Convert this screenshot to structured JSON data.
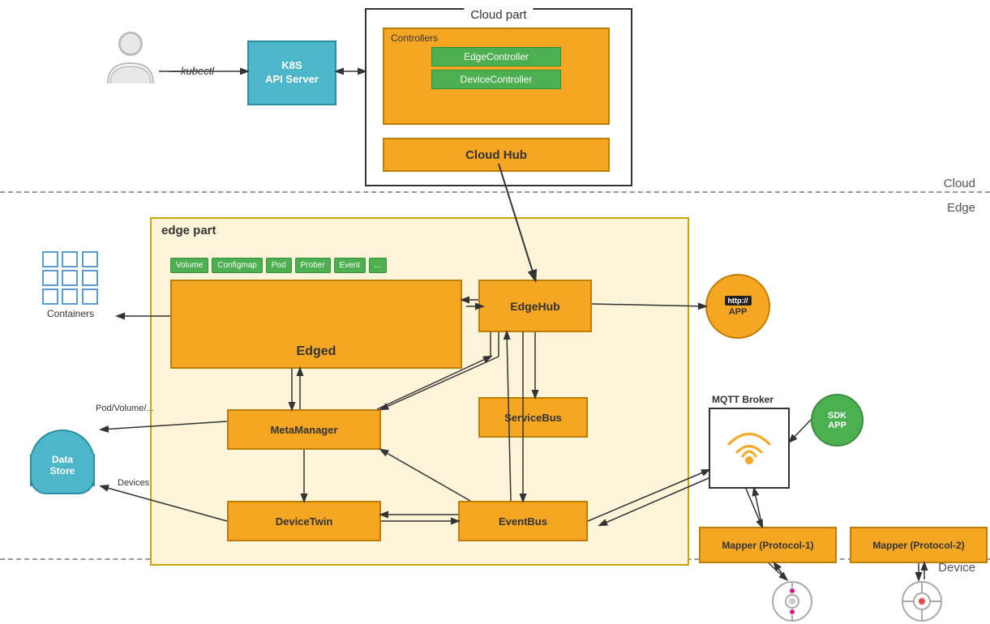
{
  "labels": {
    "cloud": "Cloud",
    "edge": "Edge",
    "device": "Device",
    "cloud_part": "Cloud part",
    "controllers": "Controllers",
    "edge_controller": "EdgeController",
    "device_controller": "DeviceController",
    "cloud_hub": "Cloud Hub",
    "k8s_api_server": "K8S\nAPI Server",
    "kubectl": "kubectl",
    "edge_part": "edge part",
    "containers": "Containers",
    "edged": "Edged",
    "edgehub": "EdgeHub",
    "metamanager": "MetaManager",
    "servicebus": "ServiceBus",
    "devicetwin": "DeviceTwin",
    "eventbus": "EventBus",
    "http_app": "APP",
    "http_badge": "http://",
    "mqtt_broker": "MQTT Broker",
    "sdk": "SDK",
    "app": "APP",
    "mapper1": "Mapper (Protocol-1)",
    "mapper2": "Mapper (Protocol-2)",
    "data_store": "Data\nStore",
    "pod_volume": "Pod/Volume/...",
    "devices": "Devices",
    "tabs": [
      "Volume",
      "Configmap",
      "Pod",
      "Prober",
      "Event",
      "..."
    ]
  },
  "colors": {
    "orange": "#f5a623",
    "orange_border": "#c07d00",
    "green": "#4caf50",
    "green_border": "#388e3c",
    "teal": "#4db6c8",
    "teal_border": "#2a8fa0",
    "edge_bg": "#fdf5d9",
    "edge_border": "#c8a800"
  }
}
